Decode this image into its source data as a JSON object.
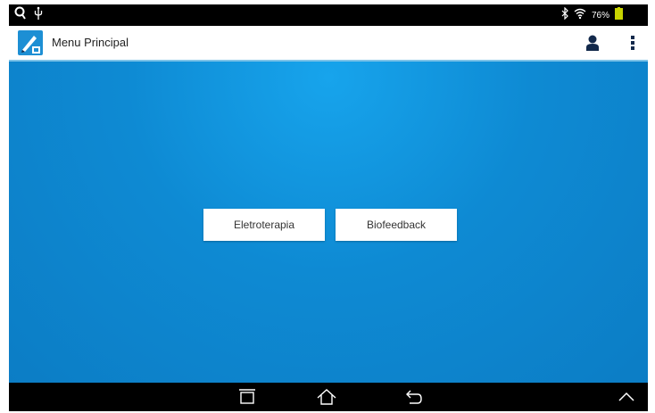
{
  "status_bar": {
    "left_icons": [
      "search-icon",
      "usb-icon"
    ],
    "right_icons": [
      "bluetooth-icon",
      "wifi-icon"
    ],
    "battery_text": "76%",
    "battery_color": "#c8d400"
  },
  "app_bar": {
    "title": "Menu Principal",
    "logo_icon": "app-logo-icon",
    "actions": [
      "account-icon",
      "overflow-menu-icon"
    ]
  },
  "main": {
    "buttons": [
      {
        "label": "Eletroterapia"
      },
      {
        "label": "Biofeedback"
      }
    ]
  },
  "nav_bar": {
    "buttons": [
      "recent-apps-icon",
      "home-icon",
      "back-icon",
      "chevron-up-icon"
    ]
  },
  "colors": {
    "background_blue": "#0f86cf",
    "app_bar_border": "#7ec3e8",
    "icon_dark": "#13294b"
  }
}
